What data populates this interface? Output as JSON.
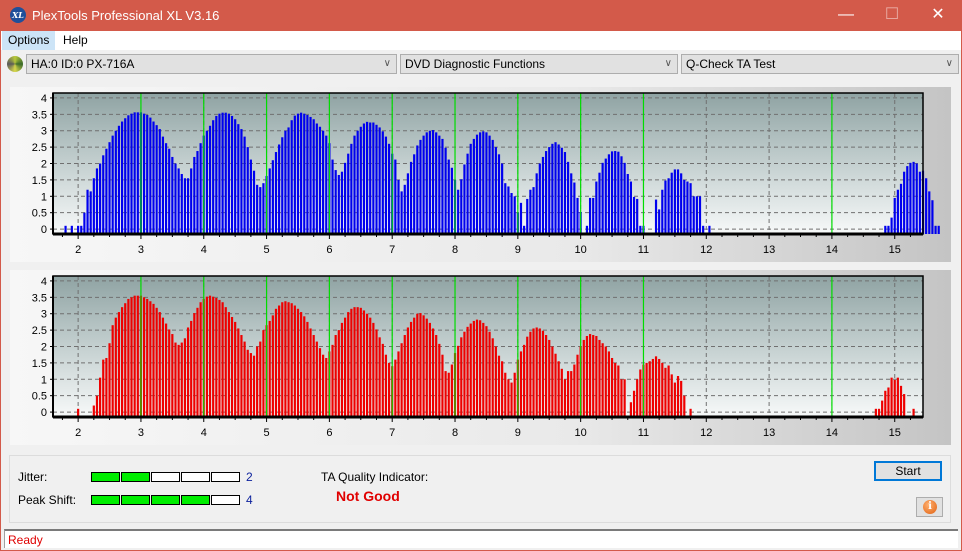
{
  "window": {
    "title": "PlexTools Professional XL V3.16",
    "app_icon_text": "XL",
    "minimize_glyph": "—",
    "maximize_glyph": "☐",
    "close_glyph": "✕"
  },
  "menu": {
    "items": [
      {
        "label": "Options"
      },
      {
        "label": "Help"
      }
    ]
  },
  "toolbar": {
    "drive_select": "HA:0 ID:0  PX-716A",
    "function_select": "DVD Diagnostic Functions",
    "test_select": "Q-Check TA Test",
    "dropdown_glyph": "∨"
  },
  "colors": {
    "titlebar": "#d35a4a",
    "top_bars": "#0000ee",
    "bottom_bars": "#ee0000",
    "marker_lines": "#00dd00",
    "meter_on": "#00ee00",
    "status_text": "#e00000"
  },
  "chart_data": [
    {
      "type": "bar",
      "title": "",
      "xlabel": "",
      "ylabel": "",
      "xlim": [
        1.6,
        15.45
      ],
      "ylim": [
        -0.15,
        4.15
      ],
      "x_ticks": [
        2,
        3,
        4,
        5,
        6,
        7,
        8,
        9,
        10,
        11,
        12,
        13,
        14,
        15
      ],
      "y_ticks": [
        "0",
        "0.5",
        "1",
        "1.5",
        "2",
        "2.5",
        "3",
        "3.5",
        "4"
      ],
      "y_tick_values": [
        0,
        0.5,
        1,
        1.5,
        2,
        2.5,
        3,
        3.5,
        4
      ],
      "grid": true,
      "markers": [
        3,
        4,
        5,
        6,
        7,
        8,
        9,
        10,
        11,
        14
      ],
      "bar_color": "#0000ee",
      "x_start": 1.8,
      "x_step": 0.05,
      "values": [
        0,
        -1,
        0,
        -1,
        0,
        0,
        0.5,
        1.2,
        1.15,
        1.55,
        1.85,
        2.0,
        2.25,
        2.45,
        2.65,
        2.85,
        3.0,
        3.15,
        3.28,
        3.38,
        3.47,
        3.52,
        3.56,
        3.56,
        3.56,
        3.52,
        3.48,
        3.4,
        3.28,
        3.17,
        3.05,
        2.82,
        2.62,
        2.45,
        2.2,
        2.0,
        1.85,
        1.68,
        1.55,
        1.55,
        1.85,
        2.2,
        2.38,
        2.62,
        2.85,
        3.0,
        3.15,
        3.32,
        3.45,
        3.52,
        3.55,
        3.55,
        3.52,
        3.45,
        3.35,
        3.2,
        3.05,
        2.82,
        2.5,
        2.12,
        1.78,
        1.35,
        1.28,
        1.4,
        1.62,
        1.85,
        2.1,
        2.35,
        2.58,
        2.8,
        3.0,
        3.1,
        3.32,
        3.46,
        3.52,
        3.55,
        3.52,
        3.48,
        3.42,
        3.35,
        3.22,
        3.12,
        3.0,
        2.85,
        2.62,
        2.12,
        1.8,
        1.65,
        1.75,
        2.02,
        2.3,
        2.6,
        2.85,
        3.0,
        3.12,
        3.22,
        3.27,
        3.25,
        3.25,
        3.18,
        3.1,
        2.98,
        2.82,
        2.6,
        2.3,
        2.12,
        1.5,
        1.15,
        1.35,
        1.7,
        2.05,
        2.28,
        2.55,
        2.72,
        2.85,
        2.95,
        3.0,
        3.02,
        2.95,
        2.85,
        2.75,
        2.48,
        2.12,
        1.87,
        1.5,
        1.2,
        1.52,
        1.97,
        2.3,
        2.6,
        2.75,
        2.88,
        2.95,
        2.98,
        2.95,
        2.85,
        2.72,
        2.5,
        2.28,
        2.0,
        1.4,
        1.3,
        1.1,
        1.0,
        0.5,
        0.8,
        0.0,
        0.92,
        1.2,
        1.28,
        1.7,
        2.0,
        2.2,
        2.38,
        2.5,
        2.6,
        2.65,
        2.58,
        2.48,
        2.35,
        2.05,
        1.7,
        1.42,
        0.95,
        0.52,
        -1,
        0,
        0.95,
        0.95,
        1.45,
        1.72,
        2.02,
        2.15,
        2.28,
        2.37,
        2.38,
        2.36,
        2.22,
        2.02,
        1.68,
        1.45,
        0.98,
        0.92,
        0.1,
        0.1,
        -1,
        -1,
        -1,
        0.9,
        0.6,
        1.2,
        1.48,
        1.55,
        1.72,
        1.82,
        1.82,
        1.7,
        1.5,
        1.45,
        1.4,
        1.0,
        1.0,
        1.0,
        0.1,
        -1,
        0.1,
        -1,
        -1,
        -1,
        -1,
        -1,
        -1,
        -1,
        -1,
        -1,
        -1,
        -1,
        -1,
        -1,
        -1,
        -1,
        -1,
        -1,
        -1,
        -1,
        -1,
        -1,
        -1,
        -1,
        -1,
        -1,
        -1,
        -1,
        -1,
        -1,
        -1,
        -1,
        -1,
        -1,
        -1,
        -1,
        -1,
        -1,
        -1,
        -1,
        -1,
        -1,
        -1,
        -1,
        -1,
        -1,
        -1,
        -1,
        -1,
        -1,
        -1,
        -1,
        -1,
        -1,
        -1,
        -1,
        0.1,
        0.1,
        0.35,
        0.95,
        1.2,
        1.38,
        1.75,
        1.92,
        2.02,
        2.05,
        2.0,
        1.75,
        1.78,
        1.55,
        1.15,
        0.88,
        0.1,
        0.1
      ]
    },
    {
      "type": "bar",
      "title": "",
      "xlabel": "",
      "ylabel": "",
      "xlim": [
        1.6,
        15.45
      ],
      "ylim": [
        -0.15,
        4.15
      ],
      "x_ticks": [
        2,
        3,
        4,
        5,
        6,
        7,
        8,
        9,
        10,
        11,
        12,
        13,
        14,
        15
      ],
      "y_ticks": [
        "0",
        "0.5",
        "1",
        "1.5",
        "2",
        "2.5",
        "3",
        "3.5",
        "4"
      ],
      "y_tick_values": [
        0,
        0.5,
        1,
        1.5,
        2,
        2.5,
        3,
        3.5,
        4
      ],
      "grid": true,
      "markers": [
        3,
        4,
        5,
        6,
        7,
        8,
        9,
        10,
        11,
        14
      ],
      "bar_color": "#ee0000",
      "x_start": 1.8,
      "x_step": 0.05,
      "values": [
        -1,
        -1,
        -1,
        -1,
        0.0,
        -1,
        -1,
        -1,
        -1,
        0.2,
        0.5,
        1.05,
        1.6,
        1.65,
        2.1,
        2.65,
        2.88,
        3.05,
        3.2,
        3.32,
        3.45,
        3.5,
        3.55,
        3.55,
        3.55,
        3.5,
        3.45,
        3.38,
        3.3,
        3.18,
        3.05,
        2.88,
        2.7,
        2.52,
        2.38,
        2.12,
        2.05,
        2.12,
        2.25,
        2.58,
        2.78,
        3.02,
        3.18,
        3.35,
        3.45,
        3.52,
        3.55,
        3.52,
        3.48,
        3.42,
        3.35,
        3.2,
        3.05,
        2.9,
        2.75,
        2.55,
        2.35,
        2.15,
        1.9,
        1.8,
        1.72,
        2.0,
        2.15,
        2.5,
        2.65,
        2.78,
        2.95,
        3.15,
        3.25,
        3.35,
        3.38,
        3.35,
        3.32,
        3.25,
        3.15,
        3.05,
        2.92,
        2.75,
        2.55,
        2.35,
        2.15,
        1.95,
        1.75,
        1.65,
        1.85,
        2.05,
        2.35,
        2.5,
        2.72,
        2.88,
        3.05,
        3.15,
        3.2,
        3.2,
        3.18,
        3.1,
        3.0,
        2.88,
        2.72,
        2.52,
        2.28,
        2.08,
        1.75,
        1.5,
        1.4,
        1.6,
        1.85,
        2.1,
        2.35,
        2.58,
        2.75,
        2.88,
        3.0,
        3.02,
        2.95,
        2.85,
        2.72,
        2.55,
        2.35,
        2.08,
        1.75,
        1.25,
        1.2,
        1.45,
        1.8,
        2.02,
        2.28,
        2.45,
        2.6,
        2.7,
        2.78,
        2.82,
        2.8,
        2.72,
        2.62,
        2.45,
        2.25,
        2.0,
        1.72,
        1.55,
        1.2,
        1.0,
        0.9,
        1.2,
        1.6,
        1.85,
        2.05,
        2.3,
        2.45,
        2.55,
        2.58,
        2.55,
        2.48,
        2.35,
        2.2,
        2.0,
        1.78,
        1.55,
        1.32,
        1.0,
        1.25,
        1.25,
        1.45,
        1.75,
        2.0,
        2.2,
        2.32,
        2.38,
        2.35,
        2.32,
        2.2,
        2.1,
        2.0,
        1.85,
        1.65,
        1.5,
        1.42,
        1.0,
        1.0,
        -1,
        0.3,
        0.65,
        1.0,
        1.3,
        1.45,
        1.5,
        1.55,
        1.62,
        1.7,
        1.62,
        1.5,
        1.35,
        1.42,
        1.15,
        0.9,
        1.1,
        0.95,
        0.5,
        -1,
        0.1,
        -1,
        -1,
        -1,
        -1,
        -1,
        -1,
        -1,
        -1,
        -1,
        -1,
        -1,
        -1,
        -1,
        -1,
        -1,
        -1,
        -1,
        -1,
        -1,
        -1,
        -1,
        -1,
        -1,
        -1,
        -1,
        -1,
        -1,
        -1,
        -1,
        -1,
        -1,
        -1,
        -1,
        -1,
        -1,
        -1,
        -1,
        -1,
        -1,
        -1,
        -1,
        -1,
        -1,
        -1,
        -1,
        -1,
        -1,
        -1,
        -1,
        -1,
        -1,
        -1,
        -1,
        -1,
        -1,
        -1,
        -1,
        -1,
        0.1,
        0.1,
        0.35,
        0.65,
        0.75,
        1.05,
        0.98,
        1.05,
        0.8,
        0.55,
        -1,
        -1,
        0.1
      ]
    }
  ],
  "results": {
    "jitter_label": "Jitter:",
    "jitter_value": "2",
    "jitter_level": 2,
    "peak_shift_label": "Peak Shift:",
    "peak_shift_value": "4",
    "peak_shift_level": 4,
    "meter_segments": 5,
    "ta_quality_label": "TA Quality Indicator:",
    "ta_quality_value": "Not Good"
  },
  "buttons": {
    "start": "Start",
    "info_glyph": "i"
  },
  "status": {
    "text": "Ready"
  }
}
